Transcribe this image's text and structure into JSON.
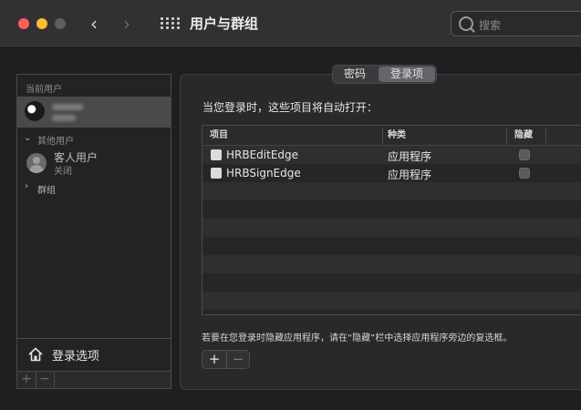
{
  "window": {
    "title": "用户与群组"
  },
  "toolbar": {
    "back_icon": "‹",
    "forward_icon": "›",
    "search_placeholder": "搜索"
  },
  "sidebar": {
    "current_user_section": "当前用户",
    "other_users_section": "其他用户",
    "guest": {
      "name": "客人用户",
      "status": "关闭"
    },
    "groups_label": "群组",
    "login_options_label": "登录选项",
    "add_label": "+",
    "remove_label": "−",
    "caret_down": "⌄",
    "caret_right": "›"
  },
  "tabs": [
    {
      "label": "密码",
      "active": false
    },
    {
      "label": "登录项",
      "active": true
    }
  ],
  "login_items": {
    "intro": "当您登录时，这些项目将自动打开：",
    "columns": [
      "项目",
      "种类",
      "隐藏"
    ],
    "rows": [
      {
        "name": "HRBEditEdge",
        "kind": "应用程序",
        "hidden": false
      },
      {
        "name": "HRBSignEdge",
        "kind": "应用程序",
        "hidden": false
      }
    ],
    "hint": "若要在您登录时隐藏应用程序，请在“隐藏”栏中选择应用程序旁边的复选框。",
    "add_label": "+",
    "remove_label": "−"
  },
  "colors": {
    "row_even": "#2f2e31",
    "row_odd": "#262528",
    "accent_close": "#ff5f57",
    "accent_min": "#febc2e"
  }
}
